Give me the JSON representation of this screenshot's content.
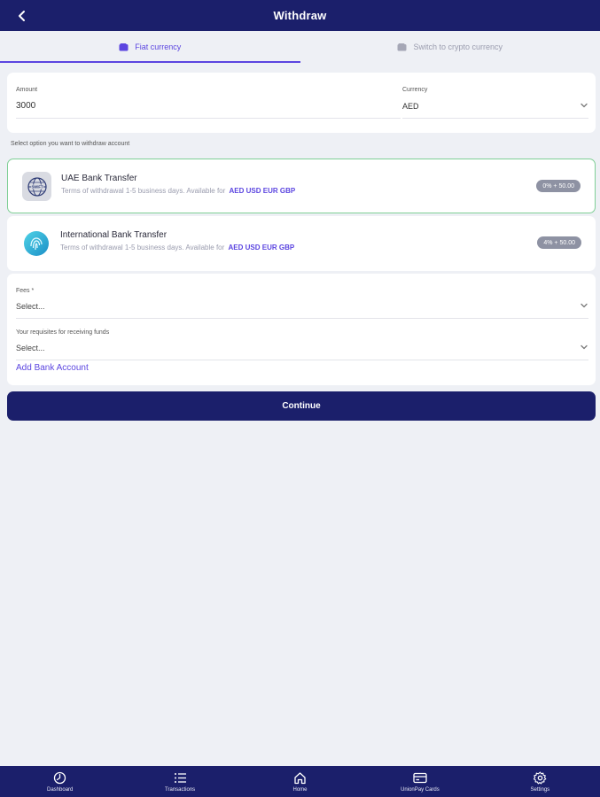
{
  "header": {
    "title": "Withdraw",
    "back_icon": "chevron-left-icon"
  },
  "tabs": [
    {
      "label": "Fiat currency",
      "icon": "wallet-icon",
      "active": true
    },
    {
      "label": "Switch to crypto currency",
      "icon": "wallet-icon",
      "active": false
    }
  ],
  "amount": {
    "label": "Amount",
    "value": "3000"
  },
  "currency": {
    "label": "Currency",
    "value": "AED"
  },
  "section_caption": "Select option you want to withdraw account",
  "options": [
    {
      "title": "UAE Bank Transfer",
      "terms": "Terms of withdrawal 1-5 business days. Available for",
      "currencies": "AED USD EUR GBP",
      "fee": "0% + 50.00",
      "icon": "swift-icon",
      "selected": true
    },
    {
      "title": "International Bank Transfer",
      "terms": "Terms of withdrawal 1-5 business days. Available for",
      "currencies": "AED USD EUR GBP",
      "fee": "4% + 50.00",
      "icon": "fingerprint-icon",
      "selected": false
    }
  ],
  "fees": {
    "label": "Fees *",
    "placeholder": "Select..."
  },
  "requisites": {
    "label": "Your requisites for receiving funds",
    "placeholder": "Select..."
  },
  "add_bank_label": "Add Bank Account",
  "continue_label": "Continue",
  "bottom_nav": [
    {
      "label": "Dashboard",
      "icon": "dashboard-icon"
    },
    {
      "label": "Transactions",
      "icon": "list-icon"
    },
    {
      "label": "Home",
      "icon": "home-icon"
    },
    {
      "label": "UnionPay Cards",
      "icon": "card-icon"
    },
    {
      "label": "Settings",
      "icon": "gear-icon"
    }
  ],
  "colors": {
    "primary": "#1b1f6b",
    "accent": "#5b45e0",
    "selected_border": "#7fcf95",
    "background": "#eef0f5"
  }
}
